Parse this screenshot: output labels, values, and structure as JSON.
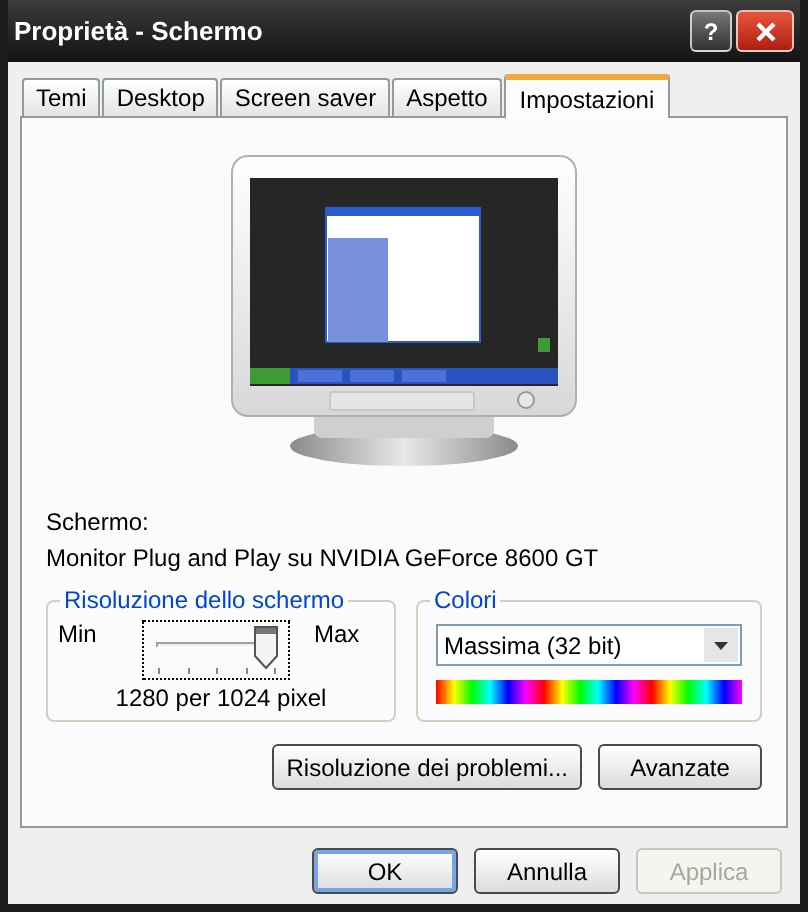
{
  "window": {
    "title": "Proprietà - Schermo",
    "help": "?"
  },
  "tabs": [
    {
      "label": "Temi",
      "selected": false
    },
    {
      "label": "Desktop",
      "selected": false
    },
    {
      "label": "Screen saver",
      "selected": false
    },
    {
      "label": "Aspetto",
      "selected": false
    },
    {
      "label": "Impostazioni",
      "selected": true
    }
  ],
  "display": {
    "label": "Schermo:",
    "device": "Monitor Plug and Play su NVIDIA GeForce 8600 GT"
  },
  "resolution": {
    "title": "Risoluzione dello schermo",
    "min_label": "Min",
    "max_label": "Max",
    "level": 1,
    "focused": true,
    "reading": "1280 per 1024 pixel"
  },
  "colors": {
    "title": "Colori",
    "value": "Massima (32 bit)"
  },
  "buttons": [
    {
      "label": "Risoluzione dei problemi..."
    },
    {
      "label": "Avanzate"
    }
  ],
  "dialog_buttons": [
    {
      "label": "OK",
      "default": true,
      "disabled": false
    },
    {
      "label": "Annulla",
      "default": false,
      "disabled": false
    },
    {
      "label": "Applica",
      "default": false,
      "disabled": true
    }
  ]
}
